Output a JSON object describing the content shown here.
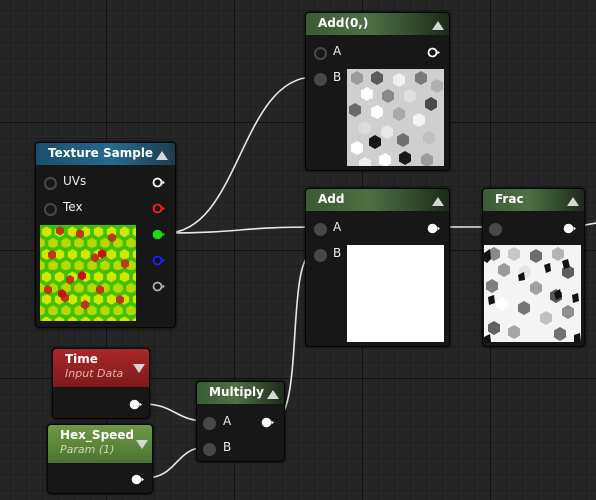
{
  "nodes": {
    "texture_sample": {
      "title": "Texture Sample",
      "pins": {
        "uvs": "UVs",
        "tex": "Tex"
      }
    },
    "add0": {
      "title": "Add(0,)",
      "pins": {
        "a": "A",
        "b": "B"
      }
    },
    "add": {
      "title": "Add",
      "pins": {
        "a": "A",
        "b": "B"
      }
    },
    "frac": {
      "title": "Frac"
    },
    "time": {
      "title": "Time",
      "subtitle": "Input Data"
    },
    "multiply": {
      "title": "Multiply",
      "pins": {
        "a": "A",
        "b": "B"
      }
    },
    "hex_speed": {
      "title": "Hex_Speed",
      "subtitle": "Param (1)"
    }
  },
  "icons": {
    "collapse": "collapse-arrow-icon",
    "expand": "expand-arrow-icon",
    "pin": "exec-pin-icon"
  },
  "colors": {
    "canvas": "#262626",
    "wire": "#e8e8e8",
    "pin_white": "#ffffff",
    "pin_red": "#ff2020",
    "pin_green": "#10e010",
    "pin_blue": "#2020ff",
    "pin_gray": "#b0b0b0"
  }
}
